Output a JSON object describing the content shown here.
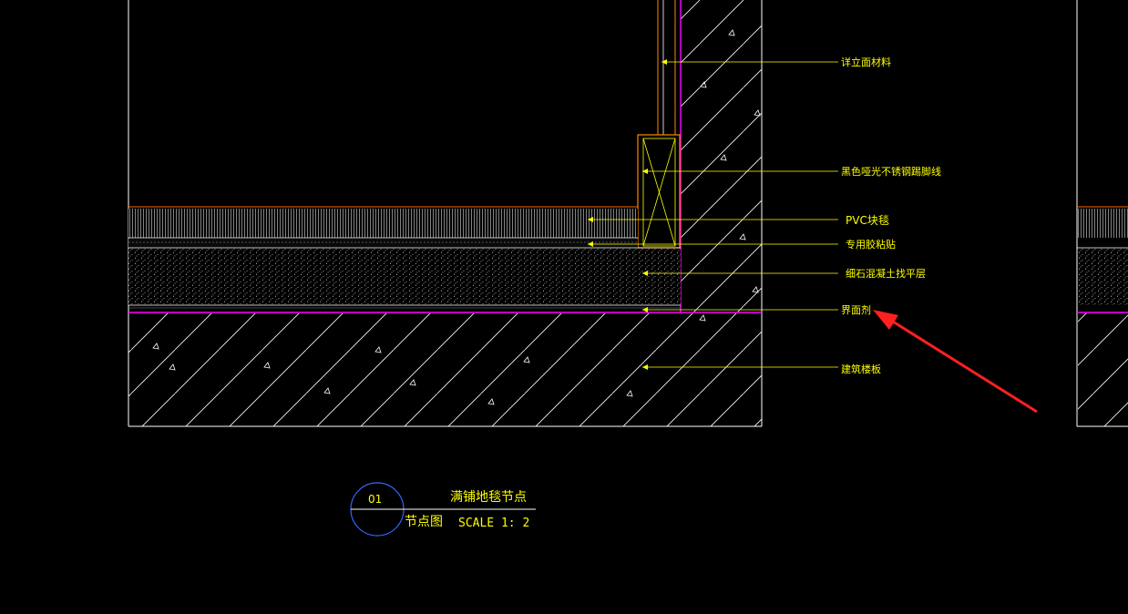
{
  "drawing": {
    "annotations": [
      "详立面材料",
      "黑色哑光不锈钢踢脚线",
      "PVC块毯",
      "专用胶粘贴",
      "细石混凝土找平层",
      "界面剂",
      "建筑楼板"
    ],
    "title_block": {
      "detail_number": "01",
      "title": "满铺地毯节点",
      "subtitle": "节点图",
      "scale": "SCALE 1: 2"
    }
  },
  "colors": {
    "background": "#000000",
    "outline": "#ffffff",
    "leader": "#ffff00",
    "wall_face": "#ff00ff",
    "skirting": "#ff8800",
    "carpet": "#ff6600",
    "title_circle": "#3366ff",
    "arrow": "#ff2020"
  }
}
